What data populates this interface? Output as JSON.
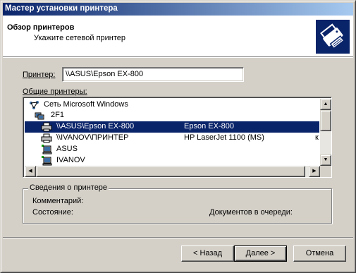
{
  "window": {
    "title": "Мастер установки принтера"
  },
  "header": {
    "title": "Обзор принтеров",
    "subtitle": "Укажите сетевой принтер",
    "icon": "printer-icon"
  },
  "printer_field": {
    "label": "Принтер:",
    "value": "\\\\ASUS\\Epson EX-800"
  },
  "shared_printers": {
    "label": "Общие принтеры:",
    "rows": [
      {
        "name": "Сеть Microsoft Windows",
        "model": "",
        "extra": "",
        "icon": "network-icon",
        "selected": false
      },
      {
        "name": "2F1",
        "model": "",
        "extra": "",
        "icon": "workgroup-icon",
        "selected": false
      },
      {
        "name": "\\\\ASUS\\Epson EX-800",
        "model": "Epson EX-800",
        "extra": "",
        "icon": "printer-icon",
        "selected": true
      },
      {
        "name": "\\\\IVANOV\\ПРИНТЕР",
        "model": "HP LaserJet 1100 (MS)",
        "extra": "к",
        "icon": "printer-icon",
        "selected": false
      },
      {
        "name": "ASUS",
        "model": "",
        "extra": "",
        "icon": "computer-icon",
        "selected": false
      },
      {
        "name": "IVANOV",
        "model": "",
        "extra": "",
        "icon": "computer-icon",
        "selected": false
      }
    ]
  },
  "printer_info": {
    "title": "Сведения о принтере",
    "comment_label": "Комментарий:",
    "status_label": "Состояние:",
    "queue_label": "Документов в очереди:"
  },
  "buttons": {
    "back": "< Назад",
    "next": "Далее >",
    "cancel": "Отмена"
  },
  "colors": {
    "title_bar": "#0a246a",
    "selection": "#0a246a",
    "face": "#d4d0c8"
  }
}
